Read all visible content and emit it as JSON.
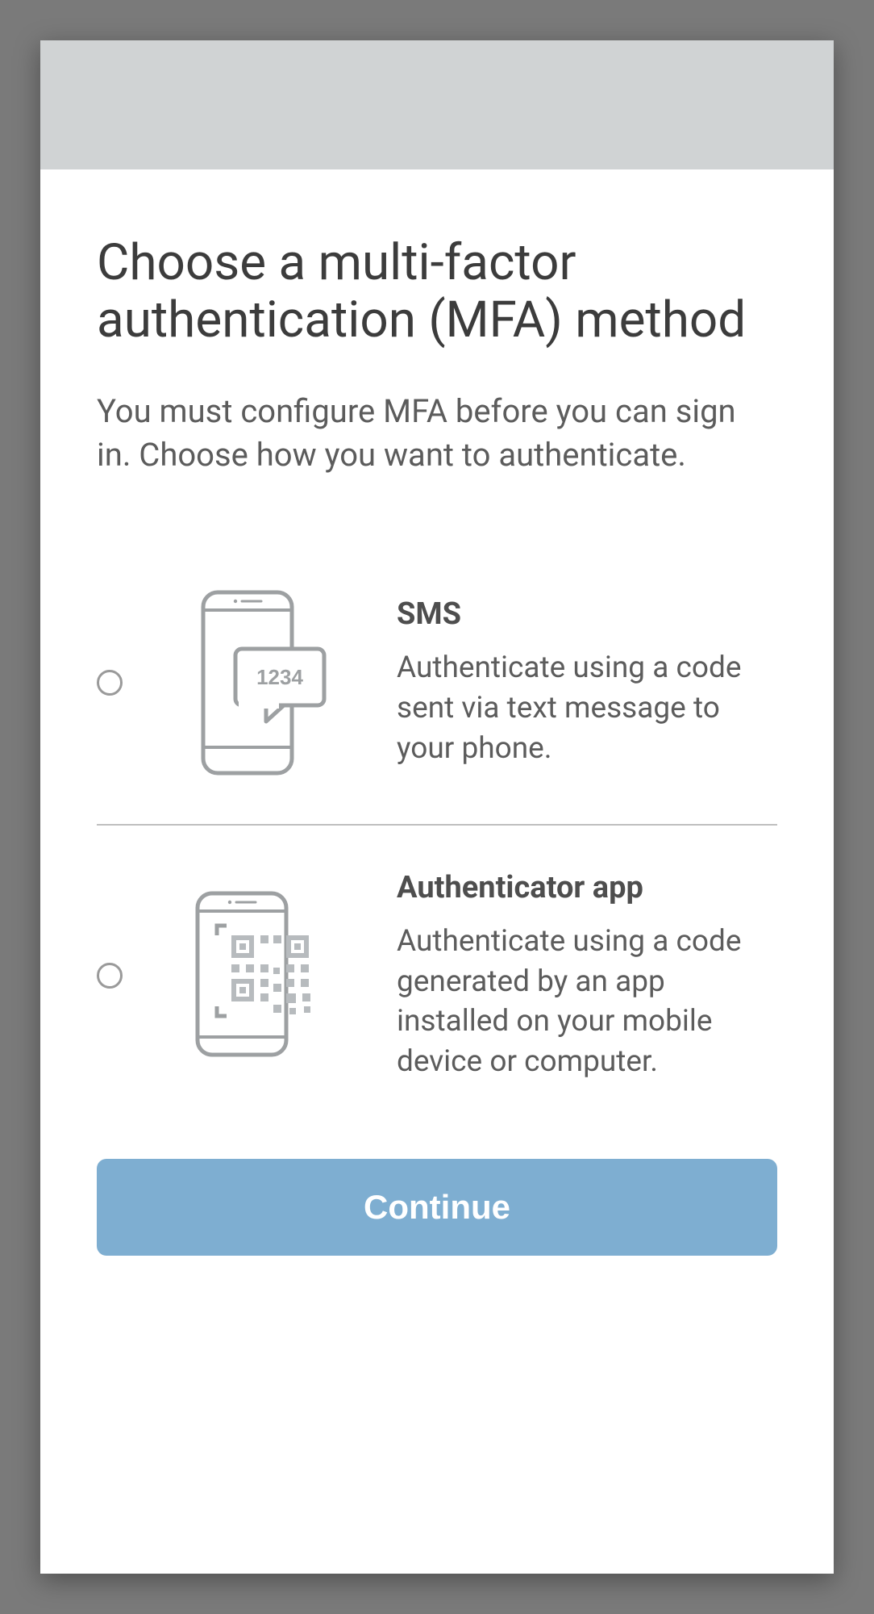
{
  "header": {
    "title": "Choose a multi-factor authentication (MFA) method",
    "subtitle": "You must configure MFA before you can sign in. Choose how you want to authenticate."
  },
  "options": [
    {
      "id": "sms",
      "title": "SMS",
      "description": "Authenticate using a code sent via text message to your phone.",
      "icon_code": "1234"
    },
    {
      "id": "authenticator",
      "title": "Authenticator app",
      "description": "Authenticate using a code generated by an app installed on your mobile device or computer."
    }
  ],
  "actions": {
    "continue": "Continue"
  }
}
